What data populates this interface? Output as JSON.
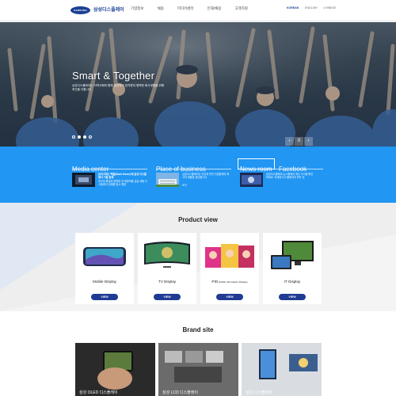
{
  "header": {
    "logo_text": "SAMSUNG",
    "site_name": "삼성디스플레이",
    "nav": [
      "기업정보",
      "채용",
      "미디어센터",
      "인재/채용",
      "고객지원"
    ],
    "util": [
      "KOREAN",
      "ENGLISH",
      "CHINESE"
    ]
  },
  "hero": {
    "title": "Smart & Together",
    "subtitle": "삼성디스플레이는 지역사회와 함께 발전하고 임직원이 행복한 회사생활을 위해 최선을 다합니다.",
    "slide_count": 4,
    "active_slide": 2,
    "controls": [
      "‹",
      "II",
      "›"
    ]
  },
  "band": {
    "media": {
      "heading": "Media center",
      "title": "[보도자료] '백홈(Back Home)'에 삼성 디스플레이 기술 탑재",
      "body": "최고의 화질과 완벽한 색 재현력을 갖춘 대형 디스플레이 신제품 출시 예정"
    },
    "business": {
      "heading": "Place of business",
      "text": "삼성디스플레이는 아산과 천안 사업장에서 최고의 제품을 생산합니다.",
      "link": "보기"
    },
    "newsroom": {
      "heading": "News room",
      "heading2": "Facebook",
      "text": "삼성디스플레이 뉴스룸에서 최신 소식을 확인하세요. 차세대 디스플레이의 모든 것."
    }
  },
  "product_view": {
    "title": "Product view",
    "button_label": "VIEW",
    "items": [
      {
        "label": "Mobile Display",
        "small": ""
      },
      {
        "label": "TV Display",
        "small": ""
      },
      {
        "label": "PID",
        "small": " (Public Information Display)"
      },
      {
        "label": "IT Display",
        "small": ""
      }
    ]
  },
  "brand_site": {
    "title": "Brand site",
    "items": [
      "삼성 OLED 디스플레이",
      "삼성 LCD 디스플레이",
      "삼성 디스플레이"
    ]
  },
  "colors": {
    "brand_navy": "#1c3f94",
    "band_blue": "#2196f3",
    "button_navy": "#1f3b93",
    "section_gray": "#eeeeee"
  }
}
